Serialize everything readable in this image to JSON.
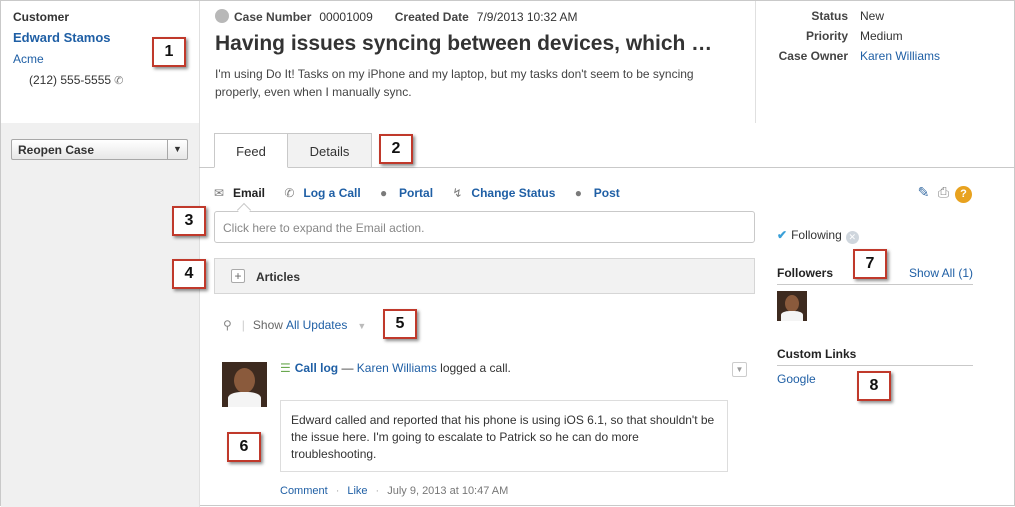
{
  "customer": {
    "label": "Customer",
    "name": "Edward Stamos",
    "account": "Acme",
    "phone": "(212) 555-5555"
  },
  "sidebar": {
    "reopen_label": "Reopen Case"
  },
  "case": {
    "number_label": "Case Number",
    "number": "00001009",
    "created_label": "Created Date",
    "created": "7/9/2013 10:32 AM",
    "title": "Having issues syncing between devices, which …",
    "description": "I'm using Do It! Tasks on my iPhone and my laptop, but my tasks don't seem to be syncing properly, even when I manually sync."
  },
  "details": {
    "status_label": "Status",
    "status": "New",
    "priority_label": "Priority",
    "priority": "Medium",
    "owner_label": "Case Owner",
    "owner": "Karen Williams"
  },
  "tabs": [
    {
      "label": "Feed",
      "active": true
    },
    {
      "label": "Details",
      "active": false
    }
  ],
  "actions": [
    {
      "label": "Email",
      "icon": "envelope-icon",
      "active": true
    },
    {
      "label": "Log a Call",
      "icon": "phone-icon"
    },
    {
      "label": "Portal",
      "icon": "people-icon"
    },
    {
      "label": "Change Status",
      "icon": "lightning-icon"
    },
    {
      "label": "Post",
      "icon": "speech-bubble-icon"
    }
  ],
  "email_placeholder": "Click here to expand the Email action.",
  "articles": {
    "label": "Articles"
  },
  "filter": {
    "show_label": "Show",
    "value": "All Updates"
  },
  "feed_item": {
    "type_label": "Call log",
    "separator": "—",
    "author": "Karen Williams",
    "action_text": "logged a call.",
    "body": "Edward called and reported that his phone is using iOS 6.1, so that shouldn't be the issue here. I'm going to escalate to Patrick so he can do more troubleshooting.",
    "comment_label": "Comment",
    "like_label": "Like",
    "timestamp": "July 9, 2013 at 10:47 AM"
  },
  "right_panel": {
    "following_label": "Following",
    "followers_label": "Followers",
    "show_all_label": "Show All (1)",
    "custom_links_label": "Custom Links",
    "custom_link": "Google"
  },
  "callouts": [
    "1",
    "2",
    "3",
    "4",
    "5",
    "6",
    "7",
    "8"
  ],
  "colors": {
    "link": "#1f5fa5",
    "callout_border": "#c0392b",
    "left_panel_bg": "#f0f0f0"
  }
}
